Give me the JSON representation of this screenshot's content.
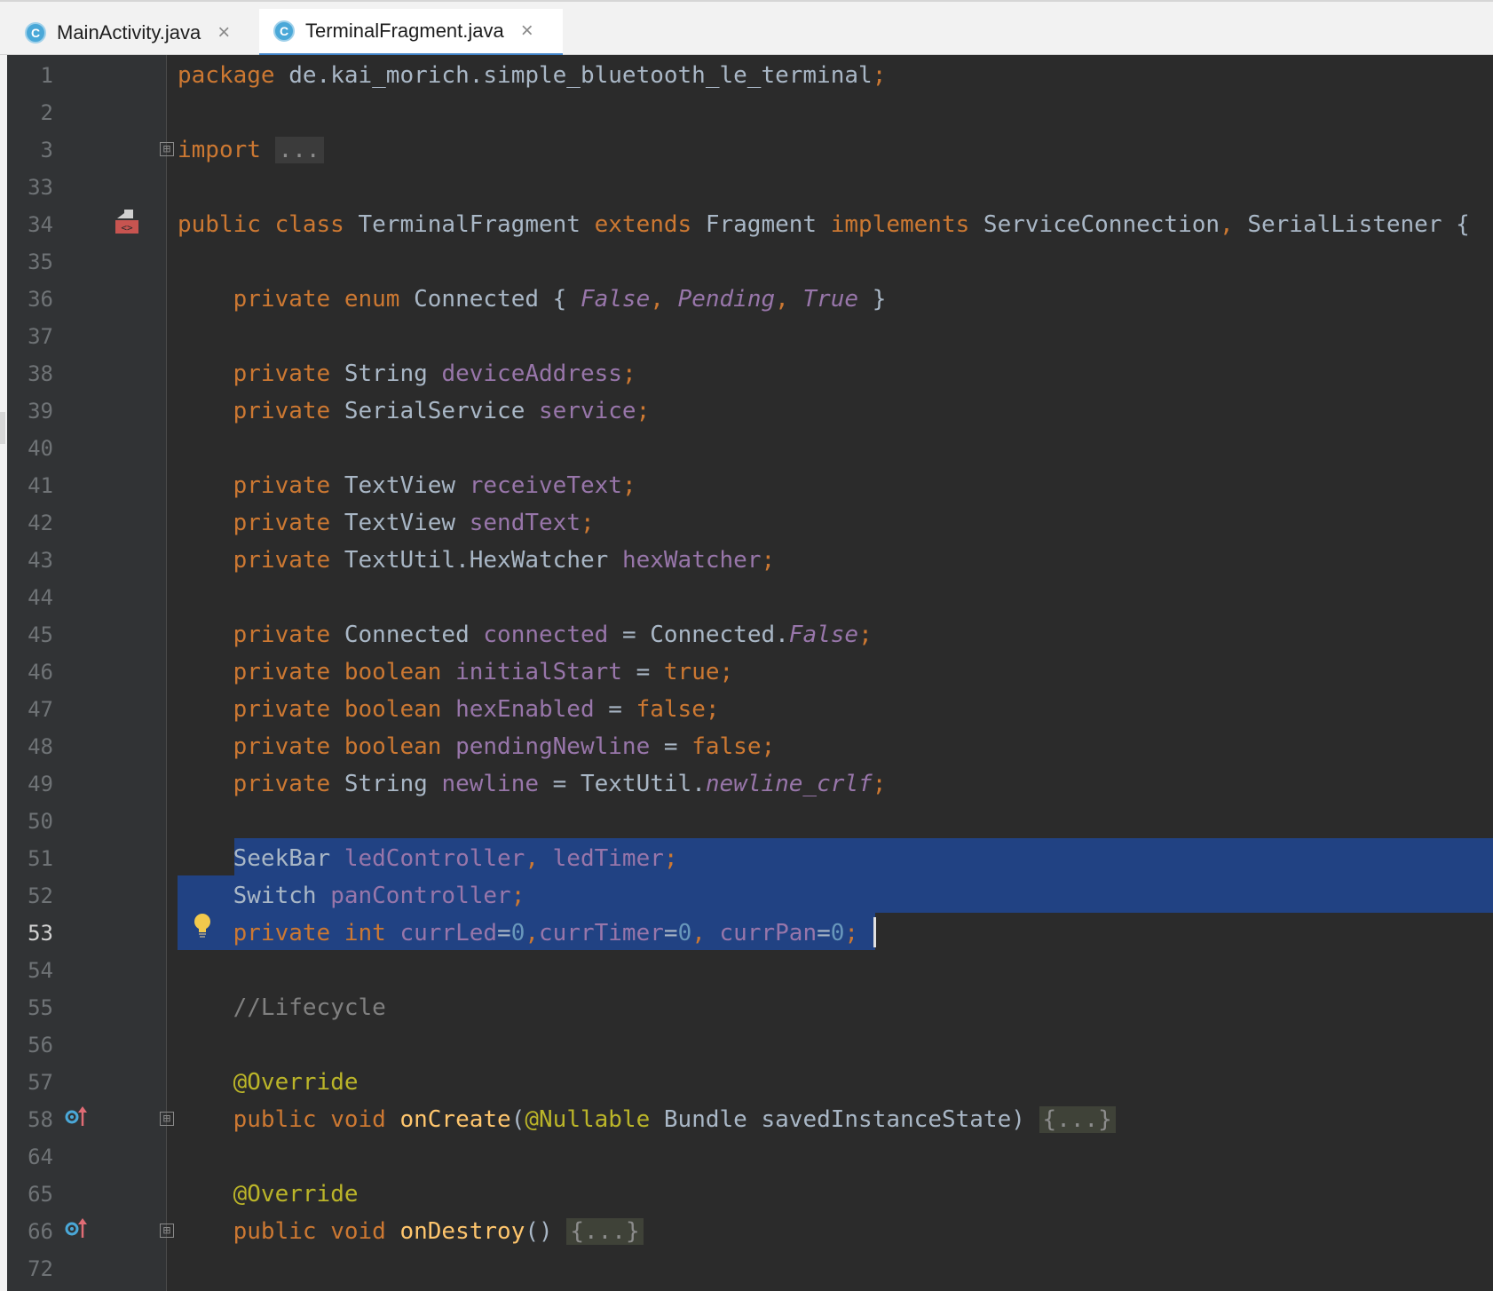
{
  "tabs": [
    {
      "label": "MainActivity.java",
      "icon": "C",
      "close": "×",
      "active": false
    },
    {
      "label": "TerminalFragment.java",
      "icon": "C",
      "close": "×",
      "active": true
    }
  ],
  "editor": {
    "current_line": "53",
    "lines": [
      {
        "n": "1",
        "tokens": [
          [
            "kw",
            "package "
          ],
          [
            "",
            "de.kai_morich.simple_bluetooth_le_terminal"
          ],
          [
            "kw",
            ";"
          ]
        ]
      },
      {
        "n": "2",
        "tokens": []
      },
      {
        "n": "3",
        "tokens": [
          [
            "kw",
            "import "
          ],
          [
            "fold-chip",
            "..."
          ]
        ]
      },
      {
        "n": "33",
        "tokens": []
      },
      {
        "n": "34",
        "tokens": [
          [
            "kw",
            "public class "
          ],
          [
            "",
            "TerminalFragment "
          ],
          [
            "kw",
            "extends "
          ],
          [
            "",
            "Fragment "
          ],
          [
            "kw",
            "implements "
          ],
          [
            "",
            "ServiceConnection"
          ],
          [
            "kw",
            ", "
          ],
          [
            "",
            "SerialListener {"
          ]
        ]
      },
      {
        "n": "35",
        "tokens": []
      },
      {
        "n": "36",
        "tokens": [
          [
            "",
            "    "
          ],
          [
            "kw",
            "private enum "
          ],
          [
            "",
            "Connected { "
          ],
          [
            "enumc",
            "False"
          ],
          [
            "kw",
            ", "
          ],
          [
            "enumc",
            "Pending"
          ],
          [
            "kw",
            ", "
          ],
          [
            "enumc",
            "True"
          ],
          [
            "",
            " }"
          ]
        ]
      },
      {
        "n": "37",
        "tokens": []
      },
      {
        "n": "38",
        "tokens": [
          [
            "",
            "    "
          ],
          [
            "kw",
            "private "
          ],
          [
            "",
            "String "
          ],
          [
            "fld",
            "deviceAddress"
          ],
          [
            "kw",
            ";"
          ]
        ]
      },
      {
        "n": "39",
        "tokens": [
          [
            "",
            "    "
          ],
          [
            "kw",
            "private "
          ],
          [
            "",
            "SerialService "
          ],
          [
            "fld",
            "service"
          ],
          [
            "kw",
            ";"
          ]
        ]
      },
      {
        "n": "40",
        "tokens": []
      },
      {
        "n": "41",
        "tokens": [
          [
            "",
            "    "
          ],
          [
            "kw",
            "private "
          ],
          [
            "",
            "TextView "
          ],
          [
            "fld",
            "receiveText"
          ],
          [
            "kw",
            ";"
          ]
        ]
      },
      {
        "n": "42",
        "tokens": [
          [
            "",
            "    "
          ],
          [
            "kw",
            "private "
          ],
          [
            "",
            "TextView "
          ],
          [
            "fld",
            "sendText"
          ],
          [
            "kw",
            ";"
          ]
        ]
      },
      {
        "n": "43",
        "tokens": [
          [
            "",
            "    "
          ],
          [
            "kw",
            "private "
          ],
          [
            "",
            "TextUtil.HexWatcher "
          ],
          [
            "fld",
            "hexWatcher"
          ],
          [
            "kw",
            ";"
          ]
        ]
      },
      {
        "n": "44",
        "tokens": []
      },
      {
        "n": "45",
        "tokens": [
          [
            "",
            "    "
          ],
          [
            "kw",
            "private "
          ],
          [
            "",
            "Connected "
          ],
          [
            "fld",
            "connected"
          ],
          [
            "",
            " = Connected."
          ],
          [
            "stat",
            "False"
          ],
          [
            "kw",
            ";"
          ]
        ]
      },
      {
        "n": "46",
        "tokens": [
          [
            "",
            "    "
          ],
          [
            "kw",
            "private boolean "
          ],
          [
            "fld",
            "initialStart"
          ],
          [
            "",
            " = "
          ],
          [
            "kw",
            "true;"
          ]
        ]
      },
      {
        "n": "47",
        "tokens": [
          [
            "",
            "    "
          ],
          [
            "kw",
            "private boolean "
          ],
          [
            "fld",
            "hexEnabled"
          ],
          [
            "",
            " = "
          ],
          [
            "kw",
            "false;"
          ]
        ]
      },
      {
        "n": "48",
        "tokens": [
          [
            "",
            "    "
          ],
          [
            "kw",
            "private boolean "
          ],
          [
            "fld",
            "pendingNewline"
          ],
          [
            "",
            " = "
          ],
          [
            "kw",
            "false;"
          ]
        ]
      },
      {
        "n": "49",
        "tokens": [
          [
            "",
            "    "
          ],
          [
            "kw",
            "private "
          ],
          [
            "",
            "String "
          ],
          [
            "fld",
            "newline"
          ],
          [
            "",
            " = TextUtil."
          ],
          [
            "stat",
            "newline_crlf"
          ],
          [
            "kw",
            ";"
          ]
        ]
      },
      {
        "n": "50",
        "tokens": []
      },
      {
        "n": "51",
        "tokens": [
          [
            "",
            "    SeekBar "
          ],
          [
            "fld",
            "ledController"
          ],
          [
            "kw",
            ", "
          ],
          [
            "fld",
            "ledTimer"
          ],
          [
            "kw",
            ";"
          ]
        ]
      },
      {
        "n": "52",
        "tokens": [
          [
            "",
            "    Switch "
          ],
          [
            "fld",
            "panController"
          ],
          [
            "kw",
            ";"
          ]
        ]
      },
      {
        "n": "53",
        "tokens": [
          [
            "",
            "    "
          ],
          [
            "kw",
            "private int "
          ],
          [
            "fld",
            "currLed"
          ],
          [
            "",
            "="
          ],
          [
            "num",
            "0"
          ],
          [
            "kw",
            ","
          ],
          [
            "fld",
            "currTimer"
          ],
          [
            "",
            "="
          ],
          [
            "num",
            "0"
          ],
          [
            "kw",
            ", "
          ],
          [
            "fld",
            "currPan"
          ],
          [
            "",
            "="
          ],
          [
            "num",
            "0"
          ],
          [
            "kw",
            ";"
          ]
        ]
      },
      {
        "n": "54",
        "tokens": []
      },
      {
        "n": "55",
        "tokens": [
          [
            "",
            "    "
          ],
          [
            "cmt",
            "//Lifecycle"
          ]
        ]
      },
      {
        "n": "56",
        "tokens": []
      },
      {
        "n": "57",
        "tokens": [
          [
            "",
            "    "
          ],
          [
            "ann",
            "@Override"
          ]
        ]
      },
      {
        "n": "58",
        "tokens": [
          [
            "",
            "    "
          ],
          [
            "kw",
            "public void "
          ],
          [
            "fn",
            "onCreate"
          ],
          [
            "",
            "("
          ],
          [
            "ann",
            "@Nullable "
          ],
          [
            "",
            "Bundle savedInstanceState) "
          ],
          [
            "fold-chip2",
            "{...}"
          ]
        ]
      },
      {
        "n": "64",
        "tokens": []
      },
      {
        "n": "65",
        "tokens": [
          [
            "",
            "    "
          ],
          [
            "ann",
            "@Override"
          ]
        ]
      },
      {
        "n": "66",
        "tokens": [
          [
            "",
            "    "
          ],
          [
            "kw",
            "public void "
          ],
          [
            "fn",
            "onDestroy"
          ],
          [
            "",
            "() "
          ],
          [
            "fold-chip2",
            "{...}"
          ]
        ]
      },
      {
        "n": "72",
        "tokens": []
      }
    ]
  },
  "icons": {
    "fold_expand": "⊞",
    "intention": "lightbulb-icon",
    "implemented": "implementation-icon",
    "overrides": "override-icon"
  },
  "colors": {
    "keyword": "#cc7832",
    "field": "#9876aa",
    "number": "#6897bb",
    "annotation": "#bbb529",
    "method": "#ffc66d",
    "comment": "#808080",
    "selection": "#214283",
    "background": "#2b2b2b",
    "gutter": "#313335"
  }
}
